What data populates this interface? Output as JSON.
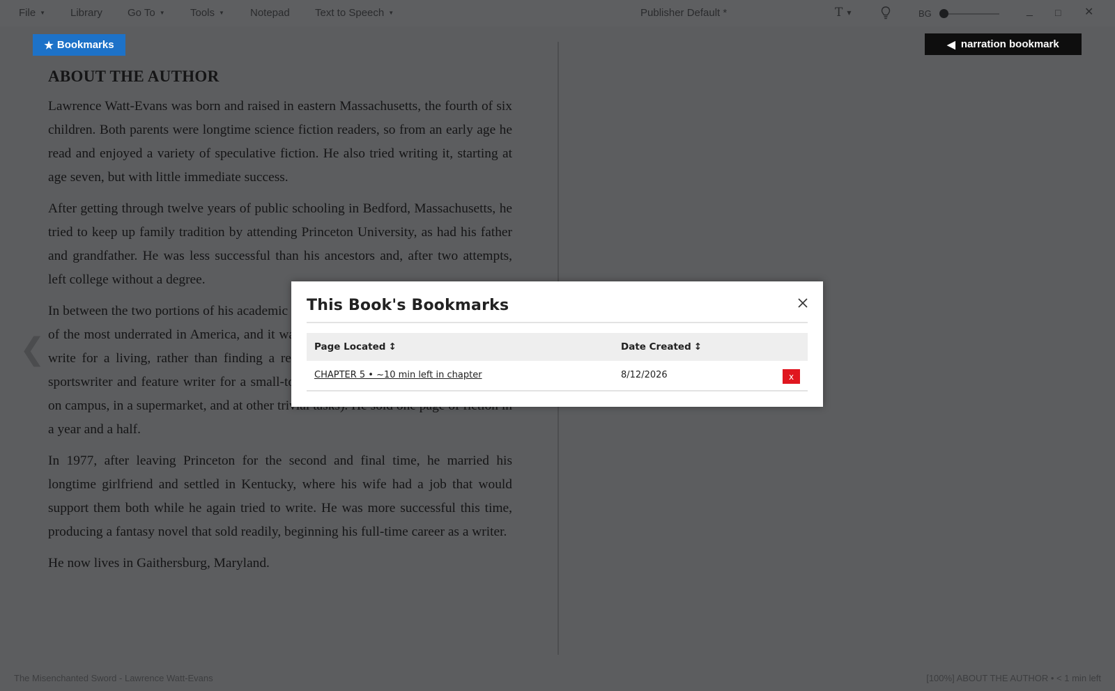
{
  "menu": {
    "file": "File",
    "library": "Library",
    "goto": "Go To",
    "tools": "Tools",
    "notepad": "Notepad",
    "tts": "Text to Speech",
    "publisher": "Publisher Default *",
    "font_icon": "T",
    "bg_label": "BG",
    "minimize": "_",
    "maximize": "□",
    "close": "✕"
  },
  "toolbar": {
    "bookmarks_label": "Bookmarks",
    "bookmarks_icon": "★",
    "narration_label": "narration bookmark",
    "narration_icon": "◀"
  },
  "page": {
    "heading": "ABOUT THE AUTHOR",
    "paragraphs": [
      "Lawrence Watt-Evans was born and raised in eastern Massachusetts, the fourth of six children. Both parents were longtime science fiction readers, so from an early age he read and enjoyed a variety of speculative fiction. He also tried writing it, starting at age seven, but with little immediate success.",
      "After getting through twelve years of public schooling in Bedford, Massachusetts, he tried to keep up family tradition by attending Princeton University, as had his father and grandfather. He was less successful than his ancestors and, after two attempts, left college without a degree.",
      "In between the two portions of his academic career he lived in a city he considers one of the most underrated in America, and it was there that he began seriously trying to write for a living, rather than finding a real job (he had previously worked as a sportswriter and feature writer for a small-town newspaper, as a sandwich salesman on campus, in a supermarket, and at other trivial tasks). He sold one page of fiction in a year and a half.",
      "In 1977, after leaving Princeton for the second and final time, he married his longtime girlfriend and settled in Kentucky, where his wife had a job that would support them both while he again tried to write. He was more successful this time, producing a fantasy novel that sold readily, beginning his full-time career as a writer.",
      "He now lives in Gaithersburg, Maryland."
    ],
    "prev_arrow": "❮"
  },
  "status": {
    "left": "The Misenchanted Sword - Lawrence Watt-Evans",
    "right": "[100%] ABOUT THE AUTHOR • < 1 min left"
  },
  "modal": {
    "title": "This Book's Bookmarks",
    "col_page": "Page Located",
    "col_date": "Date Created",
    "sort_icon": "↕",
    "rows": [
      {
        "location": "CHAPTER 5 • ~10 min left in chapter",
        "date": "8/12/2026",
        "delete": "x"
      }
    ]
  }
}
